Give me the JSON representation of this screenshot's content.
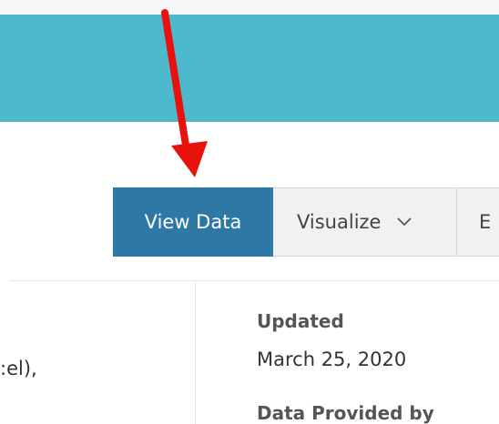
{
  "toolbar": {
    "view_data_label": "View Data",
    "visualize_label": "Visualize",
    "export_label": "E"
  },
  "description": {
    "text_fragment": ":el),"
  },
  "metadata": {
    "updated_label": "Updated",
    "updated_value": "March 25, 2020",
    "provided_by_label": "Data Provided by"
  },
  "colors": {
    "banner": "#4db9cc",
    "primary_button": "#2d78a5",
    "annotation_arrow": "#e8120c"
  },
  "icons": {
    "dropdown": "chevron-down-icon",
    "annotation": "red-arrow-annotation"
  }
}
